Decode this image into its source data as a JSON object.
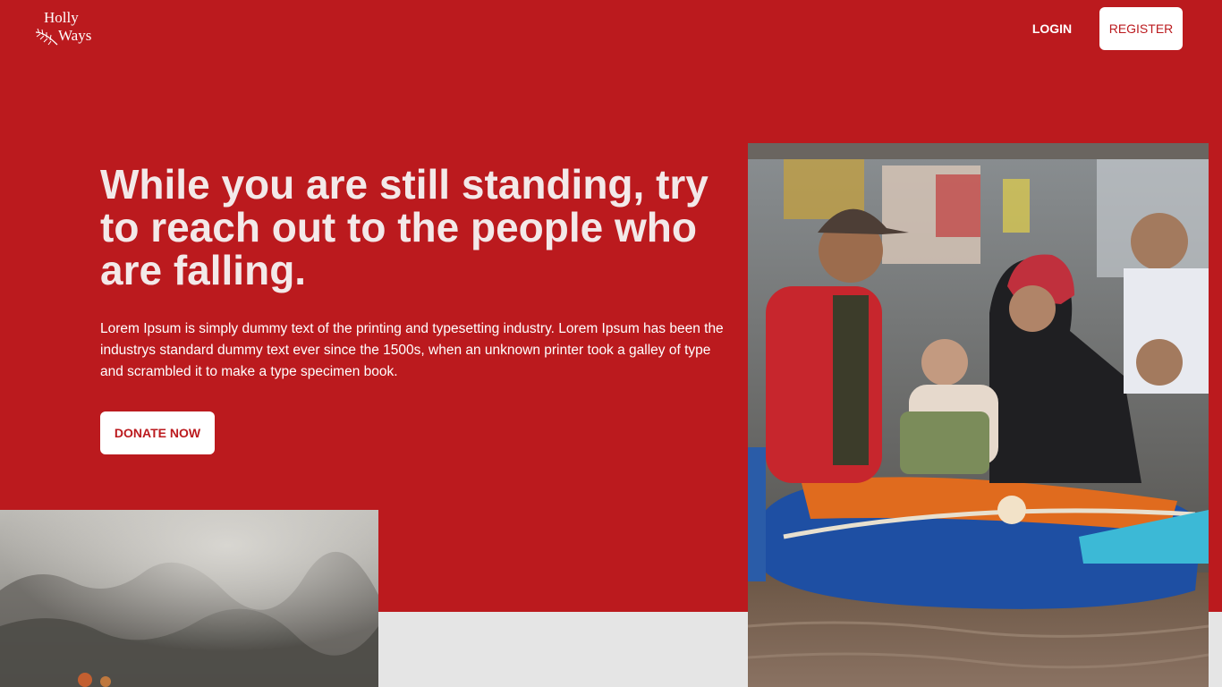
{
  "brand": {
    "logo_line1": "Holly",
    "logo_line2": "Ways"
  },
  "nav": {
    "login_label": "LOGIN",
    "register_label": "REGISTER"
  },
  "hero": {
    "headline": "While you are still standing, try to reach out to the people who are falling.",
    "paragraph": "Lorem Ipsum is simply dummy text of the printing and typesetting industry. Lorem Ipsum has been the industrys standard dummy text ever since the 1500s, when an unknown printer took a galley of type and scrambled it to make a type specimen book.",
    "donate_label": "DONATE NOW"
  },
  "colors": {
    "brand_red": "#bb1a1e",
    "page_grey": "#e5e5e5",
    "white": "#ffffff"
  },
  "images": {
    "flood_photo": "flood-rescue-photo",
    "fire_photo": "forest-fire-smoke-photo"
  }
}
